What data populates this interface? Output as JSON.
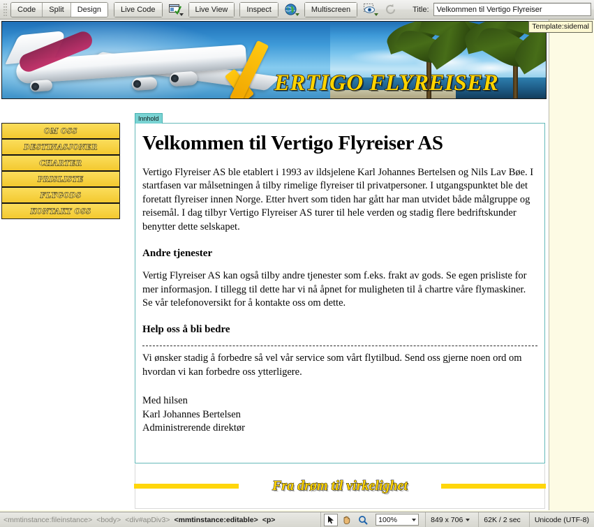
{
  "toolbar": {
    "view_modes": [
      {
        "label": "Code",
        "active": false
      },
      {
        "label": "Split",
        "active": false
      },
      {
        "label": "Design",
        "active": true
      }
    ],
    "live_code_label": "Live Code",
    "inspect_settings_icon": "code-inspect-icon",
    "live_view_label": "Live View",
    "inspect_label": "Inspect",
    "globe_icon": "globe-icon",
    "multiscreen_label": "Multiscreen",
    "live_view_eye_icon": "live-view-eye-icon",
    "refresh_icon": "refresh-icon",
    "title_label": "Title:",
    "title_value": "Velkommen til Vertigo Flyreiser"
  },
  "document": {
    "template_badge": "Template:sidemal",
    "banner": {
      "site_title": "ERTIGO FLYREISER",
      "checkmark_icon": "yellow-checkmark-icon"
    },
    "sidebar": {
      "items": [
        {
          "label": "OM OSS"
        },
        {
          "label": "DESTINASJONER"
        },
        {
          "label": "CHARTER"
        },
        {
          "label": "PRISLISTE"
        },
        {
          "label": "FLYGODS"
        },
        {
          "label": "KONTAKT OSS"
        }
      ]
    },
    "content": {
      "editable_region_label": "Innhold",
      "heading": "Velkommen til Vertigo Flyreiser AS",
      "paragraph_1": "Vertigo Flyreiser AS ble etablert i 1993 av ildsjelene Karl Johannes Bertelsen og Nils Lav Bøe. I startfasen var målsetningen å tilby rimelige flyreiser til privatpersoner. I utgangspunktet ble det foretatt flyreiser innen Norge. Etter hvert som tiden har gått har man utvidet både målgruppe og reisemål. I dag tilbyr Vertigo Flyreiser AS turer til hele verden og stadig flere bedriftskunder benytter dette selskapet.",
      "subheading_1": "Andre tjenester",
      "paragraph_2": "Vertig Flyreiser AS kan også tilby andre tjenester som f.eks. frakt av gods. Se egen prisliste for mer informasjon. I tillegg til dette har vi nå åpnet for muligheten til å chartre våre flymaskiner. Se vår telefonoversikt for å kontakte oss om dette.",
      "subheading_2": "Help oss å bli bedre",
      "paragraph_3": "Vi ønsker stadig å forbedre så vel vår service som vårt flytilbud. Send oss gjerne noen ord om hvordan vi kan forbedre oss ytterligere.",
      "signature_1": "Med hilsen",
      "signature_2": "Karl Johannes Bertelsen",
      "signature_3": "Administrerende direktør"
    },
    "footer": {
      "tagline": "Fra drøm til virkelighet"
    }
  },
  "status_bar": {
    "tag_selector": [
      {
        "label": "<mmtinstance:fileinstance>",
        "current": false
      },
      {
        "label": "<body>",
        "current": false
      },
      {
        "label": "<div#apDiv3>",
        "current": false
      },
      {
        "label": "<mmtinstance:editable>",
        "current": true
      },
      {
        "label": "<p>",
        "current": true
      }
    ],
    "select_tool_icon": "pointer-arrow-icon",
    "hand_tool_icon": "hand-icon",
    "zoom_tool_icon": "magnifier-icon",
    "zoom_value": "100%",
    "window_size": "849 x 706",
    "download_size": "62K / 2 sec",
    "encoding": "Unicode (UTF-8)"
  },
  "colors": {
    "nav_yellow": "#f3c92f",
    "accent_yellow": "#ffd400",
    "editable_teal": "#79d3d3",
    "page_bg": "#fdfbe4"
  }
}
